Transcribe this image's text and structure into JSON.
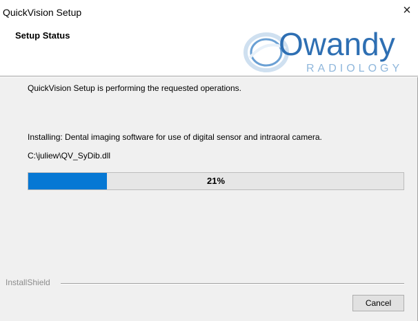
{
  "window": {
    "title": "QuickVision Setup",
    "close_glyph": "×"
  },
  "header": {
    "title": "Setup Status",
    "logo": {
      "brand": "Owandy",
      "tagline": "RADIOLOGY",
      "icon": "owandy-logo-icon"
    }
  },
  "content": {
    "status_text": "QuickVision Setup is performing the requested operations.",
    "installing_text": "Installing: Dental imaging software for use of digital sensor and intraoral camera.",
    "current_file": "C:\\juliew\\QV_SyDib.dll",
    "progress": {
      "value": 0.21,
      "label": "21%",
      "fill_color": "#0678d4"
    }
  },
  "footer": {
    "brand_label": "InstallShield",
    "cancel_label": "Cancel"
  },
  "colors": {
    "logo_blue": "#2e6fb3",
    "logo_light": "#8fb7dc"
  }
}
